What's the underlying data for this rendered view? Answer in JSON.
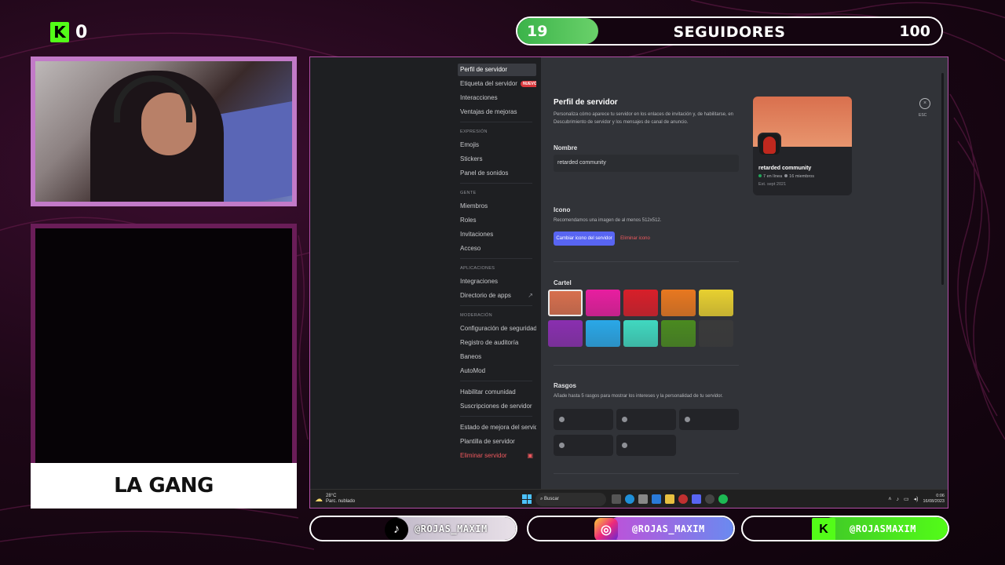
{
  "overlay": {
    "kick_count": "0",
    "followers": {
      "current": "19",
      "label": "SEGUIDORES",
      "goal": "100",
      "progress": 0.19
    },
    "gang_label": "LA GANG",
    "socials": [
      {
        "platform": "tiktok",
        "icon": "tiktok-icon",
        "handle": "@ROJAS_MAXIM"
      },
      {
        "platform": "instagram",
        "icon": "instagram-icon",
        "handle": "@ROJAS_MAXIM"
      },
      {
        "platform": "kick",
        "icon": "kick-icon",
        "handle": "@ROJASMAXIM"
      }
    ],
    "colors": {
      "kick_green": "#53fc18",
      "followers_fill": "#4cc35a",
      "frame_purple": "#c27ac8"
    }
  },
  "discord": {
    "nav": {
      "items": [
        {
          "label": "Perfil de servidor",
          "active": true
        },
        {
          "label": "Etiqueta del servidor",
          "badge": "NUEVO"
        },
        {
          "label": "Interacciones"
        },
        {
          "label": "Ventajas de mejoras"
        }
      ],
      "expresion_header": "EXPRESIÓN",
      "expresion": [
        "Emojis",
        "Stickers",
        "Panel de sonidos"
      ],
      "gente_header": "GENTE",
      "gente": [
        "Miembros",
        "Roles",
        "Invitaciones",
        "Acceso"
      ],
      "aplicaciones_header": "APLICACIONES",
      "aplicaciones": [
        "Integraciones",
        "Directorio de apps"
      ],
      "moderacion_header": "MODERACIÓN",
      "moderacion": [
        "Configuración de seguridad",
        "Registro de auditoría",
        "Baneos",
        "AutoMod"
      ],
      "comunidad": [
        "Habilitar comunidad",
        "Suscripciones de servidor"
      ],
      "extra": [
        "Estado de mejora del servidor",
        "Plantilla de servidor"
      ],
      "delete": "Eliminar servidor"
    },
    "profile": {
      "title": "Perfil de servidor",
      "description": "Personaliza cómo aparece tu servidor en los enlaces de invitación y, de habilitarse, en Descubrimiento de servidor y los mensajes de canal de anuncio.",
      "name_label": "Nombre",
      "name_value": "retarded community",
      "icon_label": "Icono",
      "icon_hint": "Recomendamos una imagen de al menos 512x512.",
      "change_icon_button": "Cambiar icono del servidor",
      "remove_icon_button": "Eliminar icono",
      "banner_label": "Cartel",
      "banner_colors": [
        "#d9704e",
        "#e81ea0",
        "#d81f2a",
        "#e87820",
        "#e8d030",
        "#8a2fb0",
        "#2aa8e8",
        "#40d8c0",
        "#4a8a20",
        "#3a3a3a"
      ],
      "traits_label": "Rasgos",
      "traits_desc": "Añade hasta 5 rasgos para mostrar los intereses y la personalidad de tu servidor."
    },
    "preview": {
      "name": "retarded community",
      "online": "7 en línea",
      "members": "16 miembros",
      "est": "Est. sept 2021"
    },
    "esc_label": "ESC",
    "taskbar": {
      "weather_temp": "28°C",
      "weather_desc": "Parc. nublado",
      "search_placeholder": "Buscar",
      "time": "0:06",
      "date": "16/08/2023"
    }
  }
}
